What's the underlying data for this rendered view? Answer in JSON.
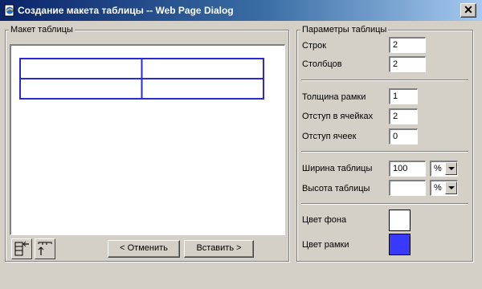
{
  "window": {
    "title": "Создание макета таблицы -- Web Page Dialog",
    "close_label": "✕"
  },
  "layout_panel": {
    "legend": "Макет таблицы",
    "undo_label": "< Отменить",
    "insert_label": "Вставить >",
    "preview_table": {
      "rows": 2,
      "cols": 2,
      "color": "#2b2bd6"
    }
  },
  "params_panel": {
    "legend": "Параметры таблицы",
    "rows_label": "Строк",
    "rows_value": "2",
    "cols_label": "Столбцов",
    "cols_value": "2",
    "border_label": "Толщина рамки",
    "border_value": "1",
    "padding_label": "Отступ в ячейках",
    "padding_value": "2",
    "spacing_label": "Отступ ячеек",
    "spacing_value": "0",
    "width_label": "Ширина таблицы",
    "width_value": "100",
    "width_unit": "%",
    "height_label": "Высота таблицы",
    "height_value": "",
    "height_unit": "%",
    "bgcolor_label": "Цвет фона",
    "bgcolor_value": "#ffffff",
    "bordercolor_label": "Цвет рамки",
    "bordercolor_value": "#3a3aff"
  }
}
